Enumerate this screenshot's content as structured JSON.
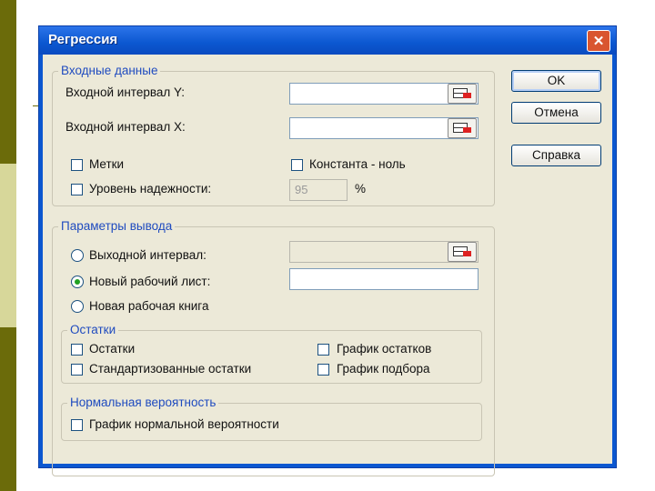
{
  "window": {
    "title": "Регрессия",
    "close_symbol": "✕"
  },
  "input_group": {
    "legend": "Входные данные",
    "y_range_label": "Входной интервал Y:",
    "y_range_value": "",
    "x_range_label": "Входной интервал X:",
    "x_range_value": "",
    "labels_checkbox": "Метки",
    "labels_checked": false,
    "constant_zero_checkbox": "Константа - ноль",
    "constant_zero_checked": false,
    "confidence_checkbox": "Уровень надежности:",
    "confidence_checked": false,
    "confidence_value": "95",
    "confidence_unit": "%"
  },
  "output_group": {
    "legend": "Параметры вывода",
    "output_range_label": "Выходной интервал:",
    "output_range_value": "",
    "new_sheet_label": "Новый рабочий лист:",
    "new_sheet_value": "",
    "new_workbook_label": "Новая рабочая книга",
    "selected_option": "new_sheet"
  },
  "residuals_group": {
    "legend": "Остатки",
    "residuals": "Остатки",
    "standardized_residuals": "Стандартизованные остатки",
    "residual_plots": "График остатков",
    "line_fit_plots": "График подбора"
  },
  "normal_group": {
    "legend": "Нормальная вероятность",
    "normal_probability_plots": "График нормальной вероятности"
  },
  "buttons": {
    "ok": "OK",
    "cancel": "Отмена",
    "help": "Справка"
  },
  "colors": {
    "title_bar": "#0b57d0",
    "dialog_bg": "#ece9d8",
    "group_legend": "#1f4bbf",
    "close_button": "#d9552f"
  }
}
